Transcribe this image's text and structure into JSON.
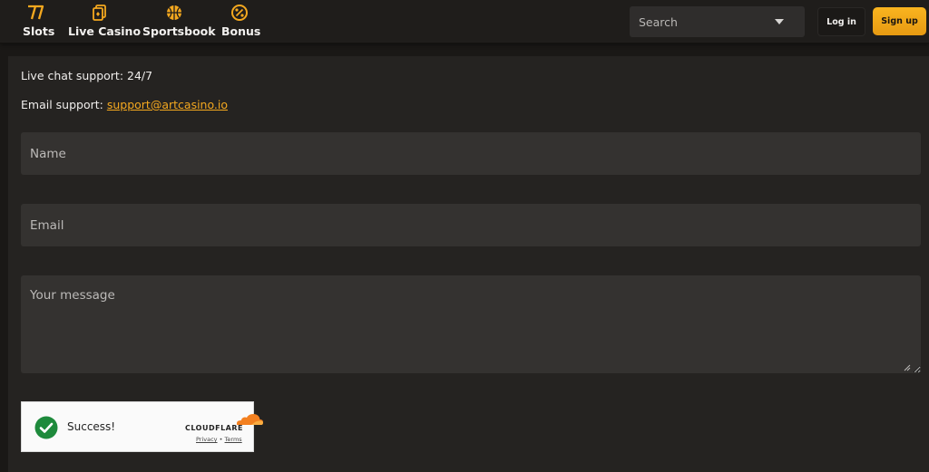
{
  "nav": {
    "items": [
      {
        "label": "Slots",
        "icon": "slots-7-icon"
      },
      {
        "label": "Live Casino",
        "icon": "cards-icon"
      },
      {
        "label": "Sportsbook",
        "icon": "basketball-icon"
      },
      {
        "label": "Bonus",
        "icon": "percent-icon"
      }
    ]
  },
  "search": {
    "placeholder": "Search"
  },
  "auth": {
    "login_label": "Log in",
    "signup_label": "Sign up"
  },
  "support": {
    "live_chat": "Live chat support: 24/7",
    "email_label": "Email support: ",
    "email": "support@artcasino.io"
  },
  "form": {
    "name_placeholder": "Name",
    "email_placeholder": "Email",
    "message_placeholder": "Your message"
  },
  "captcha": {
    "status": "Success!",
    "brand": "CLOUDFLARE",
    "privacy": "Privacy",
    "separator": "•",
    "terms": "Terms"
  },
  "colors": {
    "accent": "#f4a81f",
    "background": "#1a1816",
    "panel": "#252321",
    "field": "#343230",
    "success": "#1e8a3c"
  }
}
